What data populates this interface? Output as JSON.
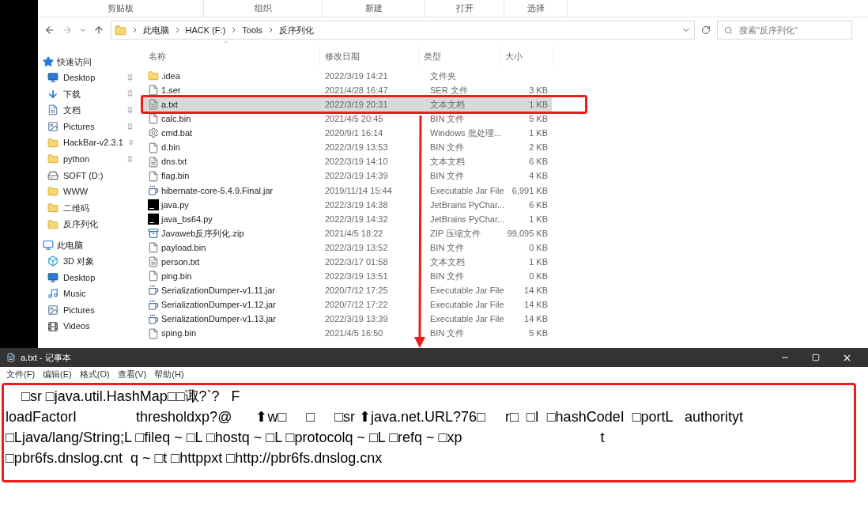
{
  "ribbon": {
    "groups": [
      "剪贴板",
      "组织",
      "新建",
      "打开",
      "选择"
    ]
  },
  "address_bar": {
    "path": [
      "此电脑",
      "HACK (F:)",
      "Tools",
      "反序列化"
    ],
    "search_placeholder": "搜索\"反序列化\""
  },
  "navigation": [
    {
      "label": "快速访问",
      "kind": "star",
      "children": [
        {
          "label": "Desktop",
          "kind": "desktop",
          "pinned": true
        },
        {
          "label": "下载",
          "kind": "download",
          "pinned": true
        },
        {
          "label": "文档",
          "kind": "document",
          "pinned": true
        },
        {
          "label": "Pictures",
          "kind": "pictures",
          "pinned": true
        },
        {
          "label": "HackBar-v2.3.1",
          "kind": "folder",
          "pinned": true
        },
        {
          "label": "python",
          "kind": "folder",
          "pinned": true
        },
        {
          "label": "SOFT (D:)",
          "kind": "drive",
          "pinned": false
        },
        {
          "label": "WWW",
          "kind": "folder",
          "pinned": false
        },
        {
          "label": "二维码",
          "kind": "folder",
          "pinned": false
        },
        {
          "label": "反序列化",
          "kind": "folder",
          "pinned": false
        }
      ]
    },
    {
      "label": "此电脑",
      "kind": "pc",
      "children": [
        {
          "label": "3D 对象",
          "kind": "cube",
          "pinned": false
        },
        {
          "label": "Desktop",
          "kind": "desktop",
          "pinned": false
        },
        {
          "label": "Music",
          "kind": "music",
          "pinned": false
        },
        {
          "label": "Pictures",
          "kind": "pictures",
          "pinned": false
        },
        {
          "label": "Videos",
          "kind": "videos",
          "pinned": false
        }
      ]
    }
  ],
  "file_list": {
    "columns": [
      "名称",
      "修改日期",
      "类型",
      "大小"
    ],
    "rows": [
      {
        "name": ".idea",
        "date": "2022/3/19 14:21",
        "type": "文件夹",
        "size": "",
        "kind": "folder",
        "selected": false
      },
      {
        "name": "1.ser",
        "date": "2021/4/28 16:47",
        "type": "SER 文件",
        "size": "3 KB",
        "kind": "file",
        "selected": false
      },
      {
        "name": "a.txt",
        "date": "2022/3/19 20:31",
        "type": "文本文档",
        "size": "1 KB",
        "kind": "text",
        "selected": true
      },
      {
        "name": "calc.bin",
        "date": "2021/4/5 20:45",
        "type": "BIN 文件",
        "size": "5 KB",
        "kind": "file",
        "selected": false
      },
      {
        "name": "cmd.bat",
        "date": "2020/9/1 16:14",
        "type": "Windows 批处理...",
        "size": "1 KB",
        "kind": "bat",
        "selected": false
      },
      {
        "name": "d.bin",
        "date": "2022/3/19 13:53",
        "type": "BIN 文件",
        "size": "2 KB",
        "kind": "file",
        "selected": false
      },
      {
        "name": "dns.txt",
        "date": "2022/3/19 14:10",
        "type": "文本文档",
        "size": "6 KB",
        "kind": "text",
        "selected": false
      },
      {
        "name": "flag.bin",
        "date": "2022/3/19 14:39",
        "type": "BIN 文件",
        "size": "4 KB",
        "kind": "file",
        "selected": false
      },
      {
        "name": "hibernate-core-5.4.9.Final.jar",
        "date": "2019/11/14 15:44",
        "type": "Executable Jar File",
        "size": "6,991 KB",
        "kind": "jar",
        "selected": false
      },
      {
        "name": "java.py",
        "date": "2022/3/19 14:38",
        "type": "JetBrains PyChar...",
        "size": "6 KB",
        "kind": "pycharm",
        "selected": false
      },
      {
        "name": "java_bs64.py",
        "date": "2022/3/19 14:32",
        "type": "JetBrains PyChar...",
        "size": "1 KB",
        "kind": "pycharm",
        "selected": false
      },
      {
        "name": "Javaweb反序列化.zip",
        "date": "2021/4/5 18:22",
        "type": "ZIP 压缩文件",
        "size": "99,095 KB",
        "kind": "zip",
        "selected": false
      },
      {
        "name": "payload.bin",
        "date": "2022/3/19 13:52",
        "type": "BIN 文件",
        "size": "0 KB",
        "kind": "file",
        "selected": false
      },
      {
        "name": "person.txt",
        "date": "2022/3/17 01:58",
        "type": "文本文档",
        "size": "1 KB",
        "kind": "text",
        "selected": false
      },
      {
        "name": "ping.bin",
        "date": "2022/3/19 13:51",
        "type": "BIN 文件",
        "size": "0 KB",
        "kind": "file",
        "selected": false
      },
      {
        "name": "SerializationDumper-v1.11.jar",
        "date": "2020/7/12 17:25",
        "type": "Executable Jar File",
        "size": "14 KB",
        "kind": "jar",
        "selected": false
      },
      {
        "name": "SerializationDumper-v1.12.jar",
        "date": "2020/7/12 17:22",
        "type": "Executable Jar File",
        "size": "14 KB",
        "kind": "jar",
        "selected": false
      },
      {
        "name": "SerializationDumper-v1.13.jar",
        "date": "2022/3/19 13:39",
        "type": "Executable Jar File",
        "size": "14 KB",
        "kind": "jar",
        "selected": false
      },
      {
        "name": "sping.bin",
        "date": "2021/4/5 16:50",
        "type": "BIN 文件",
        "size": "5 KB",
        "kind": "file",
        "selected": false
      }
    ]
  },
  "notepad": {
    "title": "a.txt - 记事本",
    "menu": [
      "文件(F)",
      "编辑(E)",
      "格式(O)",
      "查看(V)",
      "帮助(H)"
    ],
    "lines": [
      "    □sr □java.util.HashMap□□诹?`?   F",
      "loadFactorI               thresholdxp?@      ⬆w□     □     □sr ⬆java.net.URL?76□     r□  □I  □hashCodeI  □portL   authorityt",
      "□Ljava/lang/String;L □fileq ~ □L □hostq ~ □L □protocolq ~ □L □refq ~ □xp                                   t",
      "□pbr6fs.dnslog.cnt  q ~ □t □httppxt □http://pbr6fs.dnslog.cnx"
    ]
  }
}
